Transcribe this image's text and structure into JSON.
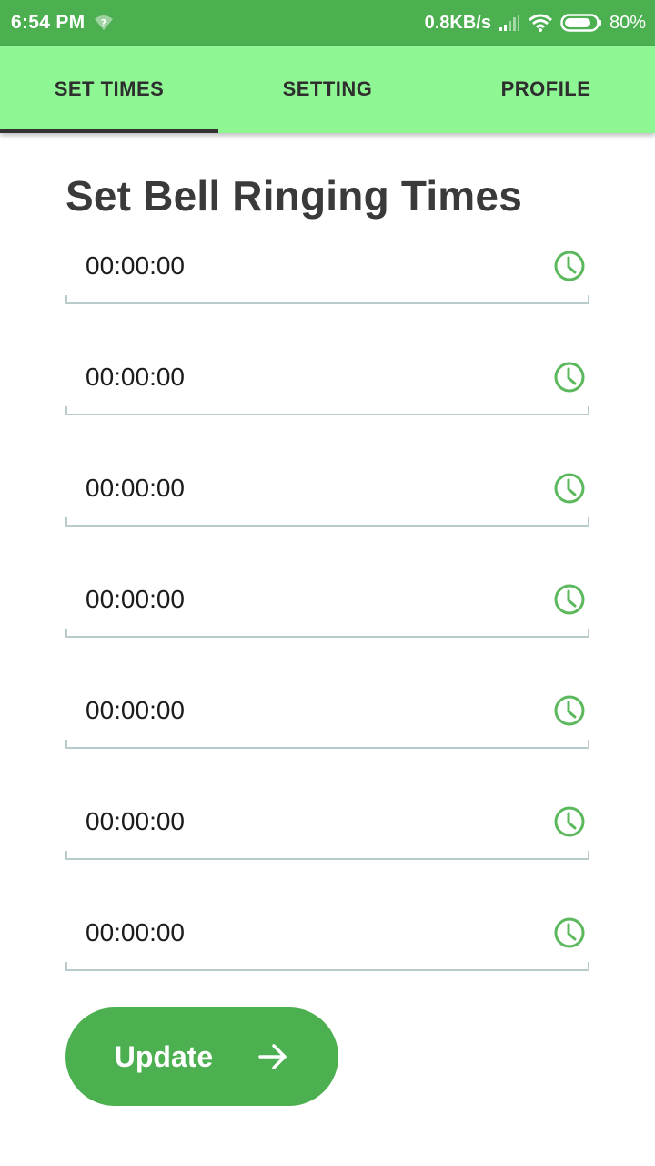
{
  "status_bar": {
    "time": "6:54 PM",
    "network_speed": "0.8KB/s",
    "battery": "80%"
  },
  "tabs": [
    {
      "label": "SET TIMES",
      "active": true
    },
    {
      "label": "SETTING",
      "active": false
    },
    {
      "label": "PROFILE",
      "active": false
    }
  ],
  "page": {
    "title": "Set Bell Ringing Times"
  },
  "time_fields": [
    {
      "value": "00:00:00"
    },
    {
      "value": "00:00:00"
    },
    {
      "value": "00:00:00"
    },
    {
      "value": "00:00:00"
    },
    {
      "value": "00:00:00"
    },
    {
      "value": "00:00:00"
    },
    {
      "value": "00:00:00"
    }
  ],
  "actions": {
    "update_label": "Update"
  },
  "colors": {
    "status_bar": "#4caf50",
    "tab_bar": "#8ef793",
    "accent": "#4caf50",
    "clock_icon": "#5cb85c"
  }
}
